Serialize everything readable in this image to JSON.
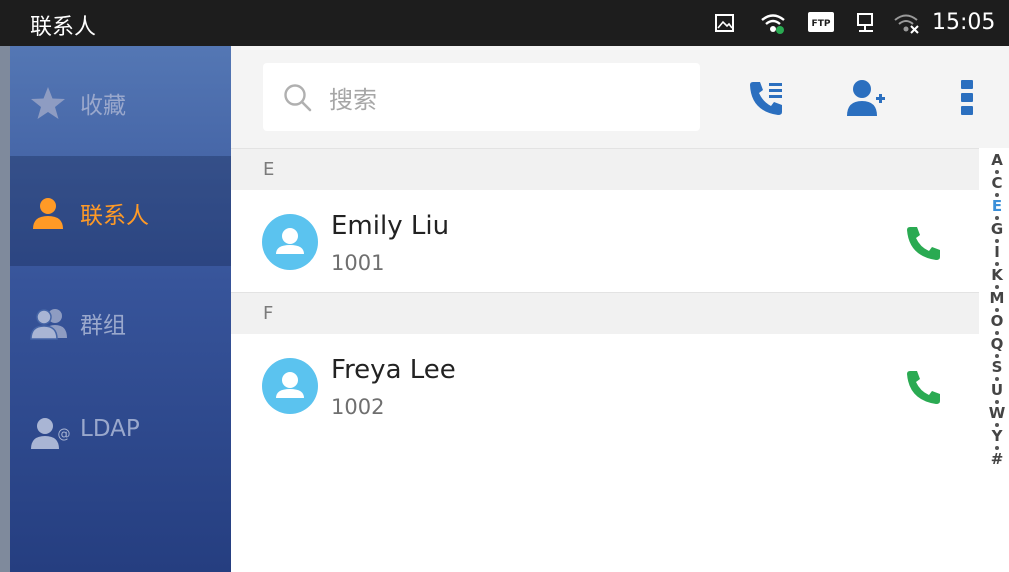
{
  "status_bar": {
    "app_title": "联系人",
    "icons": [
      "screenshot-icon",
      "wifi-icon",
      "ftp-icon",
      "network-icon",
      "wifi-disabled-icon"
    ],
    "ftp_badge": "FTP",
    "time": "15:05"
  },
  "sidebar": {
    "items": [
      {
        "label": "收藏",
        "icon": "star-icon",
        "active": false
      },
      {
        "label": "联系人",
        "icon": "person-icon",
        "active": true
      },
      {
        "label": "群组",
        "icon": "group-icon",
        "active": false
      },
      {
        "label": "LDAP",
        "icon": "ldap-icon",
        "active": false
      }
    ]
  },
  "toolbar": {
    "search_placeholder": "搜索",
    "buttons": [
      "call-log-icon",
      "add-contact-icon",
      "more-menu-icon"
    ]
  },
  "contacts": {
    "sections": [
      {
        "letter": "E",
        "name": "Emily Liu",
        "number": "1001"
      },
      {
        "letter": "F",
        "name": "Freya Lee",
        "number": "1002"
      }
    ]
  },
  "alpha_index": {
    "letters": [
      "A",
      "C",
      "E",
      "G",
      "I",
      "K",
      "M",
      "O",
      "Q",
      "S",
      "U",
      "W",
      "Y",
      "#"
    ],
    "active": "E"
  },
  "colors": {
    "accent_orange": "#ff9a26",
    "icon_blue": "#2b6fbf",
    "call_green": "#2aaa52",
    "avatar_blue": "#5bc3ef",
    "active_index": "#3a8fd9"
  }
}
